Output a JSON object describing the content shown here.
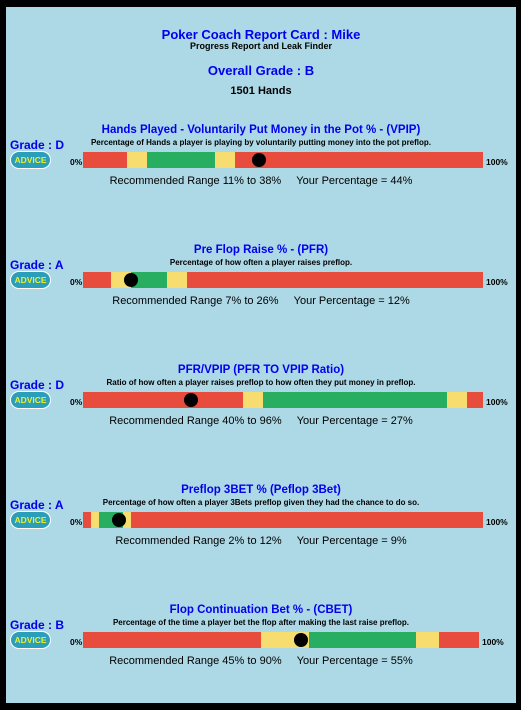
{
  "header": {
    "title": "Poker Coach Report Card : Mike",
    "subtitle": "Progress Report and Leak Finder",
    "overall_grade": "Overall Grade : B",
    "hands": "1501 Hands"
  },
  "labels": {
    "zero": "0%",
    "hundred": "100%",
    "advice": "ADVICE"
  },
  "colors": {
    "red": "#e74c3c",
    "yellow": "#f7dc6f",
    "green": "#27ae60",
    "marker": "#000000",
    "title_blue": "#0000ee",
    "background": "#add8e6",
    "advice_bg": "#2b9fb9",
    "advice_text": "#e8f030"
  },
  "stats": [
    {
      "grade": "Grade : D",
      "title": "Hands Played - Voluntarily Put Money in the Pot % - (VPIP)",
      "description": "Percentage of Hands a player is playing by voluntarily putting money into the pot preflop.",
      "recommended": "Recommended Range 11% to 38%",
      "yours": "Your Percentage = 44%",
      "value_pct": 44,
      "zones": [
        {
          "color": "red",
          "from": 0,
          "to": 11
        },
        {
          "color": "yellow",
          "from": 11,
          "to": 16
        },
        {
          "color": "green",
          "from": 16,
          "to": 33
        },
        {
          "color": "yellow",
          "from": 33,
          "to": 38
        },
        {
          "color": "red",
          "from": 38,
          "to": 100
        }
      ]
    },
    {
      "grade": "Grade : A",
      "title": "Pre Flop Raise % - (PFR)",
      "description": "Percentage of how often a player raises preflop.",
      "recommended": "Recommended Range 7% to 26%",
      "yours": "Your Percentage = 12%",
      "value_pct": 12,
      "zones": [
        {
          "color": "red",
          "from": 0,
          "to": 7
        },
        {
          "color": "yellow",
          "from": 7,
          "to": 12
        },
        {
          "color": "green",
          "from": 12,
          "to": 21
        },
        {
          "color": "yellow",
          "from": 21,
          "to": 26
        },
        {
          "color": "red",
          "from": 26,
          "to": 100
        }
      ]
    },
    {
      "grade": "Grade : D",
      "title": "PFR/VPIP (PFR TO VPIP Ratio)",
      "description": "Ratio of how often a player raises preflop to how often they put money in preflop.",
      "recommended": "Recommended Range 40% to 96%",
      "yours": "Your Percentage = 27%",
      "value_pct": 27,
      "zones": [
        {
          "color": "red",
          "from": 0,
          "to": 40
        },
        {
          "color": "yellow",
          "from": 40,
          "to": 45
        },
        {
          "color": "green",
          "from": 45,
          "to": 91
        },
        {
          "color": "yellow",
          "from": 91,
          "to": 96
        },
        {
          "color": "red",
          "from": 96,
          "to": 100
        }
      ]
    },
    {
      "grade": "Grade : A",
      "title": "Preflop 3BET % (Peflop 3Bet)",
      "description": "Percentage of how often a player 3Bets preflop given they had the chance to do so.",
      "recommended": "Recommended Range 2% to 12%",
      "yours": "Your Percentage = 9%",
      "value_pct": 9,
      "zones": [
        {
          "color": "red",
          "from": 0,
          "to": 2
        },
        {
          "color": "yellow",
          "from": 2,
          "to": 4
        },
        {
          "color": "green",
          "from": 4,
          "to": 10
        },
        {
          "color": "yellow",
          "from": 10,
          "to": 12
        },
        {
          "color": "red",
          "from": 12,
          "to": 100
        }
      ]
    },
    {
      "grade": "Grade : B",
      "title": "Flop Continuation Bet % - (CBET)",
      "description": "Percentage of the time a player bet the flop after making the last raise preflop.",
      "recommended": "Recommended Range 45% to 90%",
      "yours": "Your Percentage = 55%",
      "value_pct": 55,
      "zones": [
        {
          "color": "red",
          "from": 0,
          "to": 45
        },
        {
          "color": "yellow",
          "from": 45,
          "to": 57
        },
        {
          "color": "green",
          "from": 57,
          "to": 84
        },
        {
          "color": "yellow",
          "from": 84,
          "to": 90
        },
        {
          "color": "red",
          "from": 90,
          "to": 100
        }
      ]
    }
  ]
}
